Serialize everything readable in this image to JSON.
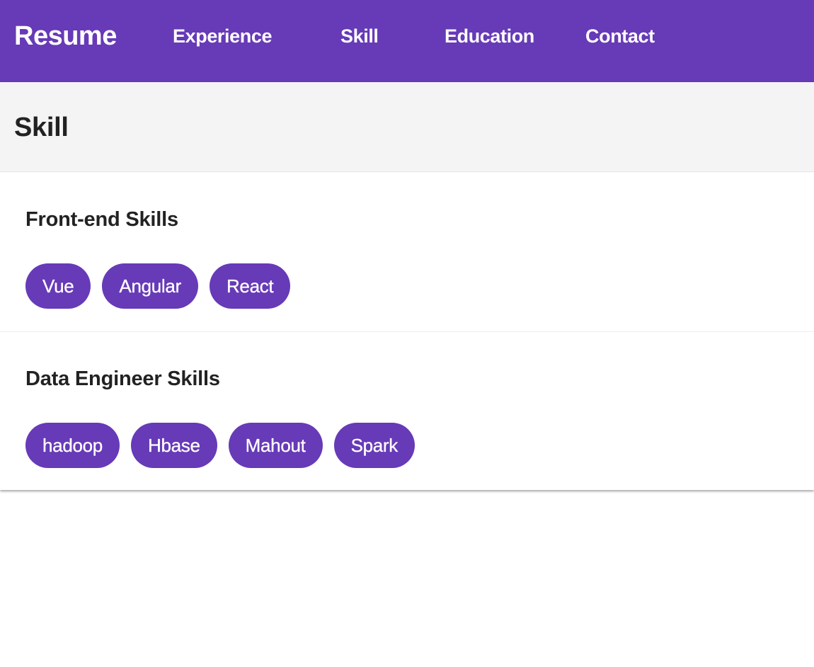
{
  "header": {
    "brand": "Resume",
    "nav": [
      {
        "label": "Experience"
      },
      {
        "label": "Skill"
      },
      {
        "label": "Education"
      },
      {
        "label": "Contact"
      }
    ]
  },
  "page": {
    "title": "Skill"
  },
  "skills": {
    "sections": [
      {
        "title": "Front-end Skills",
        "items": [
          "Vue",
          "Angular",
          "React"
        ]
      },
      {
        "title": "Data Engineer Skills",
        "items": [
          "hadoop",
          "Hbase",
          "Mahout",
          "Spark"
        ]
      }
    ]
  },
  "colors": {
    "primary": "#673ab7",
    "header_background": "#f4f4f4",
    "text": "#222222"
  }
}
